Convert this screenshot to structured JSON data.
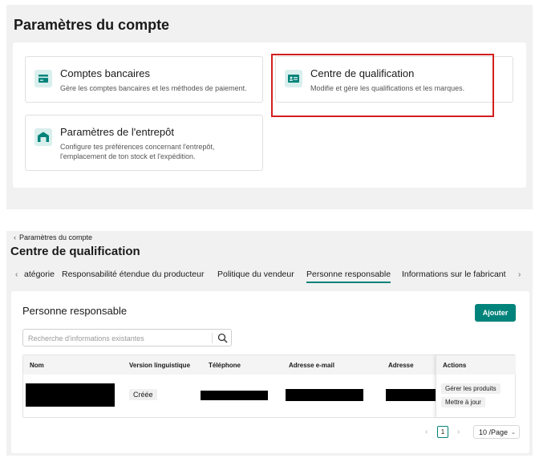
{
  "account_settings": {
    "title": "Paramètres du compte",
    "cards": [
      {
        "title": "Comptes bancaires",
        "description": "Gère les comptes bancaires et les méthodes de paiement.",
        "icon": "bank-card-icon"
      },
      {
        "title": "Centre de qualification",
        "description": "Modifie et gère les qualifications et les marques.",
        "icon": "id-card-icon"
      },
      {
        "title": "Paramètres de l'entrepôt",
        "description_line1": "Configure tes préférences concernant l'entrepôt,",
        "description_line2": "l'emplacement de ton stock et l'expédition.",
        "icon": "warehouse-icon"
      }
    ],
    "highlight_color": "#d21f1f"
  },
  "qualification_center": {
    "breadcrumb": "Paramètres du compte",
    "title": "Centre de qualification",
    "tabs": [
      {
        "label": "atégorie"
      },
      {
        "label": "Responsabilité étendue du producteur"
      },
      {
        "label": "Politique du vendeur"
      },
      {
        "label": "Personne responsable",
        "active": true
      },
      {
        "label": "Informations sur le fabricant"
      }
    ],
    "section_title": "Personne responsable",
    "add_button": "Ajouter",
    "search_placeholder": "Recherche d'informations existantes",
    "table": {
      "columns": [
        "Nom",
        "Version linguistique",
        "Téléphone",
        "Adresse e-mail",
        "Adresse",
        "Actions"
      ],
      "rows": [
        {
          "status": "Créée",
          "actions": [
            "Gérer les produits",
            "Mettre à jour"
          ]
        }
      ]
    },
    "pagination": {
      "current_page": "1",
      "page_size": "10 /Page"
    },
    "accent_color": "#00837a"
  }
}
